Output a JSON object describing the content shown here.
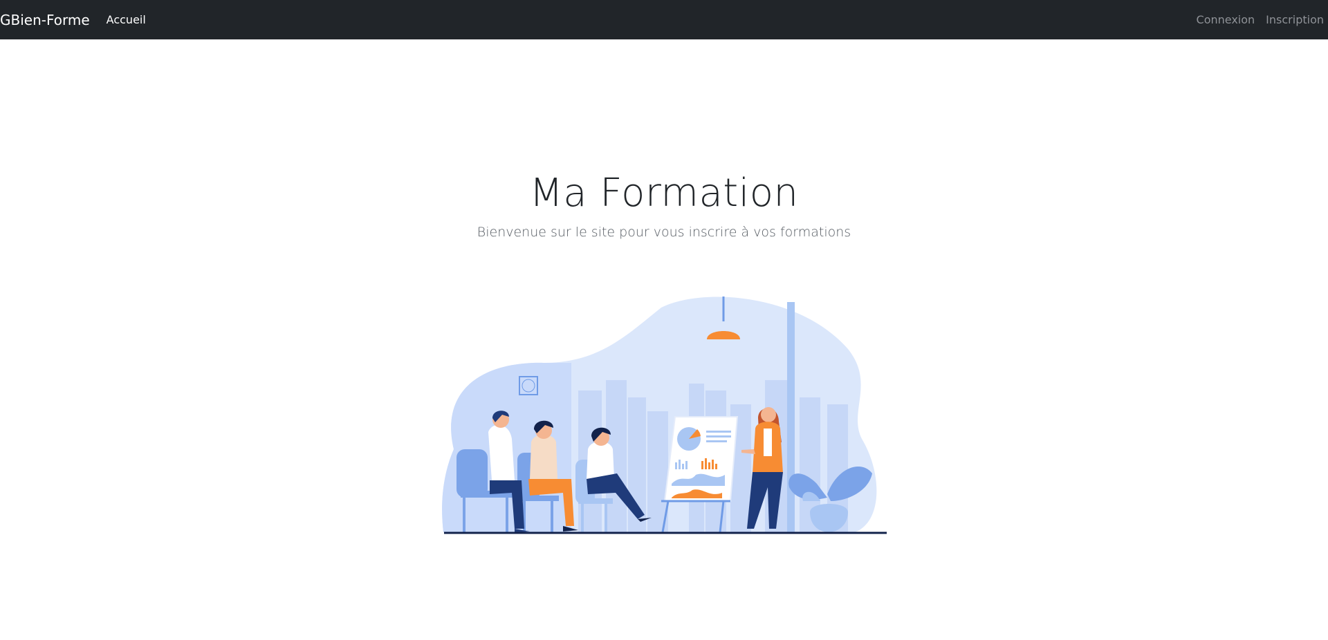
{
  "navbar": {
    "brand": "GBien-Forme",
    "links": [
      {
        "label": "Accueil"
      }
    ],
    "right_links": [
      {
        "label": "Connexion"
      },
      {
        "label": "Inscription"
      }
    ],
    "background": "#212529"
  },
  "hero": {
    "title": "Ma Formation",
    "subtitle": "Bienvenue sur le site pour vous inscrire à vos formations"
  },
  "colors": {
    "accent_orange": "#f78c33",
    "accent_blue": "#6f9be6",
    "navy": "#1f3b7a",
    "light_blue": "#dbe7fb"
  },
  "illustration": {
    "icon": "training-meeting-illustration"
  }
}
